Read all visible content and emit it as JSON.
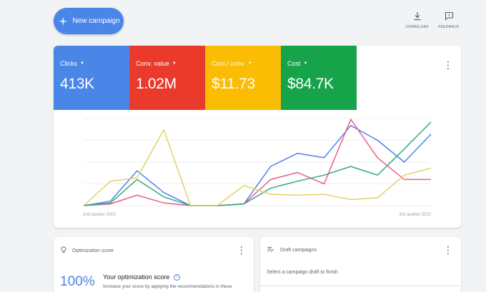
{
  "header": {
    "new_campaign_label": "New campaign",
    "download_label": "DOWNLOAD",
    "feedback_label": "FEEDBACK"
  },
  "metrics": [
    {
      "label": "Clicks",
      "value": "413K",
      "color": "#4a86e8"
    },
    {
      "label": "Conv. value",
      "value": "1.02M",
      "color": "#ea3a2c"
    },
    {
      "label": "Cost / conv.",
      "value": "$11.73",
      "color": "#fbbc04"
    },
    {
      "label": "Cost",
      "value": "$84.7K",
      "color": "#16a34a"
    }
  ],
  "chart_data": {
    "type": "line",
    "x_start_label": "2nd quarter 2019",
    "x_end_label": "3rd quarter 2022",
    "grid": true,
    "x": [
      0,
      1,
      2,
      3,
      4,
      5,
      6,
      7,
      8,
      9,
      10,
      11,
      12,
      13
    ],
    "ylim": [
      0,
      10
    ],
    "series": [
      {
        "color": "#4a86e8",
        "values": [
          0,
          0.5,
          4,
          1.5,
          0,
          0,
          0.2,
          4.5,
          6,
          5.5,
          9.2,
          7.5,
          5,
          8.2
        ]
      },
      {
        "color": "#e8608a",
        "values": [
          0,
          0.2,
          1.2,
          0.3,
          0,
          0,
          0.2,
          3,
          3.8,
          2.5,
          9.9,
          5.5,
          3,
          3
        ]
      },
      {
        "color": "#34a880",
        "values": [
          0,
          0.3,
          3,
          1,
          0,
          0,
          0.2,
          2,
          2.8,
          3.5,
          4.5,
          3.5,
          6.5,
          9.6
        ]
      },
      {
        "color": "#e0d26a",
        "values": [
          0,
          2.8,
          3.2,
          8.7,
          0,
          0,
          2.3,
          1.3,
          1.2,
          1.3,
          0.7,
          0.9,
          3.5,
          4.3
        ]
      }
    ]
  },
  "optimization": {
    "title": "Optimization score",
    "value": "100%",
    "heading": "Your optimization score",
    "description": "Increase your score by applying the recommendations in these"
  },
  "drafts": {
    "title": "Draft campaigns",
    "description": "Select a campaign draft to finish"
  }
}
